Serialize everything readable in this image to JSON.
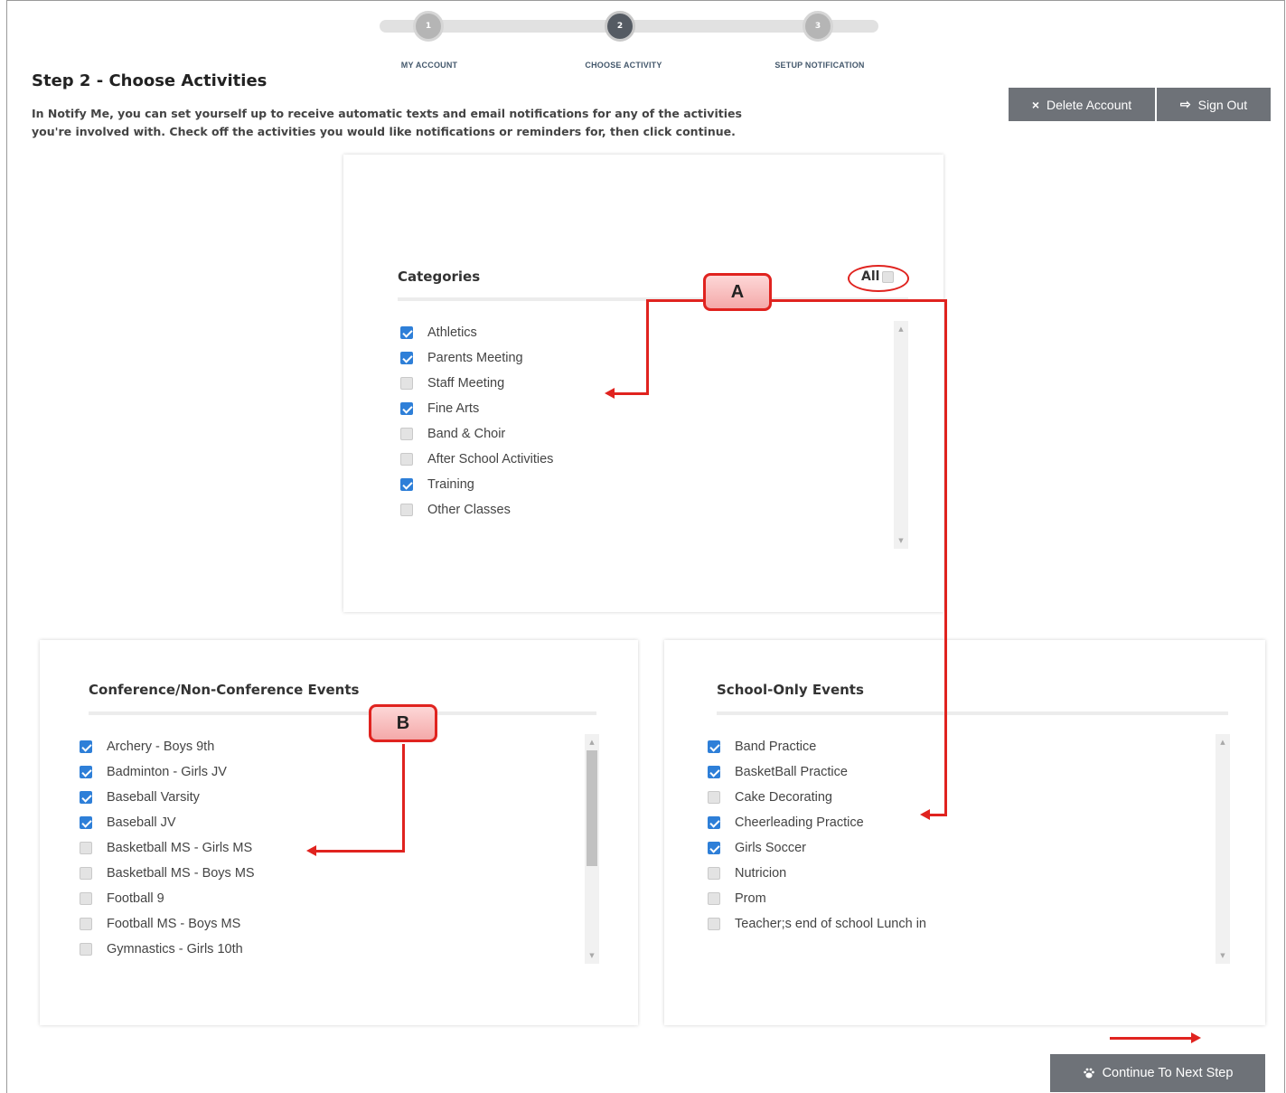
{
  "stepper": {
    "steps": [
      {
        "number": "1",
        "label": "MY ACCOUNT",
        "active": false
      },
      {
        "number": "2",
        "label": "CHOOSE ACTIVITY",
        "active": true
      },
      {
        "number": "3",
        "label": "SETUP NOTIFICATION",
        "active": false
      }
    ]
  },
  "page": {
    "title": "Step 2 - Choose Activities",
    "intro": "In Notify Me, you can set yourself up to receive automatic texts and email notifications for any of the activities you're involved with. Check off the activities you would like notifications or reminders for, then click continue."
  },
  "header_buttons": {
    "delete_label": "Delete Account",
    "delete_icon": "×",
    "signout_label": "Sign Out",
    "signout_icon": "⇨"
  },
  "categories": {
    "title": "Categories",
    "all_label": "All",
    "all_checked": false,
    "items": [
      {
        "label": "Athletics",
        "checked": true
      },
      {
        "label": "Parents Meeting",
        "checked": true
      },
      {
        "label": "Staff Meeting",
        "checked": false
      },
      {
        "label": "Fine Arts",
        "checked": true
      },
      {
        "label": "Band & Choir",
        "checked": false
      },
      {
        "label": "After School Activities",
        "checked": false
      },
      {
        "label": "Training",
        "checked": true
      },
      {
        "label": "Other Classes",
        "checked": false
      }
    ]
  },
  "conference": {
    "title": "Conference/Non-Conference Events",
    "items": [
      {
        "label": "Archery - Boys 9th",
        "checked": true
      },
      {
        "label": "Badminton - Girls JV",
        "checked": true
      },
      {
        "label": "Baseball Varsity",
        "checked": true
      },
      {
        "label": "Baseball JV",
        "checked": true
      },
      {
        "label": "Basketball MS - Girls MS",
        "checked": false
      },
      {
        "label": "Basketball MS - Boys MS",
        "checked": false
      },
      {
        "label": "Football 9",
        "checked": false
      },
      {
        "label": "Football MS - Boys MS",
        "checked": false
      },
      {
        "label": "Gymnastics - Girls 10th",
        "checked": false
      }
    ]
  },
  "school_only": {
    "title": "School-Only Events",
    "items": [
      {
        "label": "Band Practice",
        "checked": true
      },
      {
        "label": "BasketBall Practice",
        "checked": true
      },
      {
        "label": "Cake Decorating",
        "checked": false
      },
      {
        "label": "Cheerleading Practice",
        "checked": true
      },
      {
        "label": "Girls Soccer",
        "checked": true
      },
      {
        "label": "Nutricion",
        "checked": false
      },
      {
        "label": "Prom",
        "checked": false
      },
      {
        "label": "Teacher;s end of school Lunch in",
        "checked": false
      }
    ]
  },
  "annotations": {
    "callout_a": "A",
    "callout_b": "B",
    "color": "#e0231f"
  },
  "footer": {
    "continue_label": "Continue To Next Step",
    "continue_icon": "paw-icon"
  },
  "colors": {
    "checkbox_checked": "#2e7fd8",
    "button_bg": "#6e7278",
    "step_active": "#555b63"
  }
}
